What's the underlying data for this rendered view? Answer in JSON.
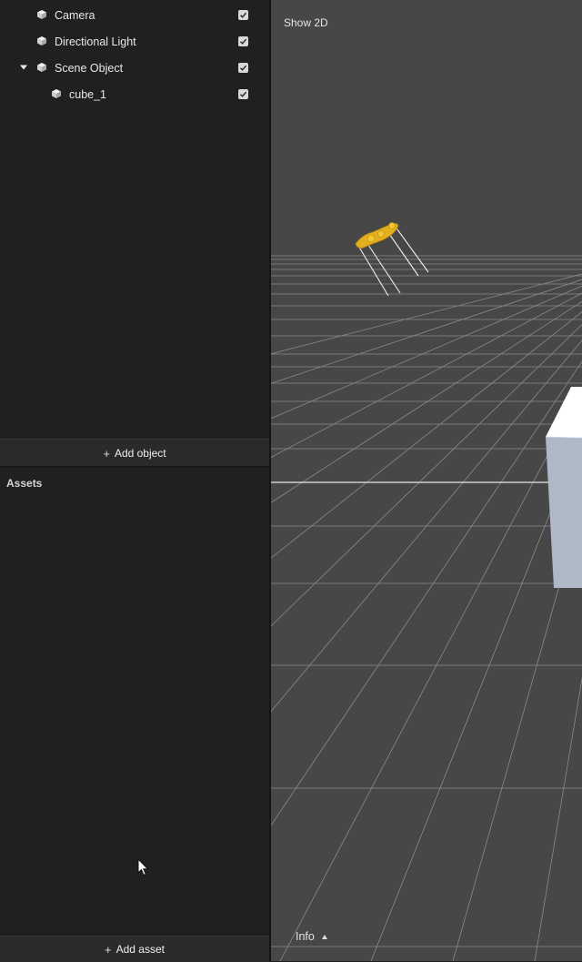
{
  "hierarchy": {
    "items": [
      {
        "label": "Camera",
        "indent": 0,
        "expandable": false,
        "visible": true
      },
      {
        "label": "Directional Light",
        "indent": 0,
        "expandable": false,
        "visible": true
      },
      {
        "label": "Scene Object",
        "indent": 0,
        "expandable": true,
        "expanded": true,
        "visible": true
      },
      {
        "label": "cube_1",
        "indent": 1,
        "expandable": false,
        "visible": true
      }
    ],
    "add_object_label": "Add object"
  },
  "assets": {
    "title": "Assets",
    "add_asset_label": "Add asset"
  },
  "viewport": {
    "show2d_label": "Show 2D",
    "info_label": "Info",
    "background_color": "#474747",
    "grid_color": "#8c8c8c",
    "cube_color": "#aeb8c7",
    "camera_gizmo_color": "#e6b422"
  },
  "icons": {
    "object": "cube-icon",
    "expand": "chevron-down-icon",
    "visibility": "check-icon",
    "add": "plus-icon",
    "info_caret": "caret-up-icon"
  }
}
